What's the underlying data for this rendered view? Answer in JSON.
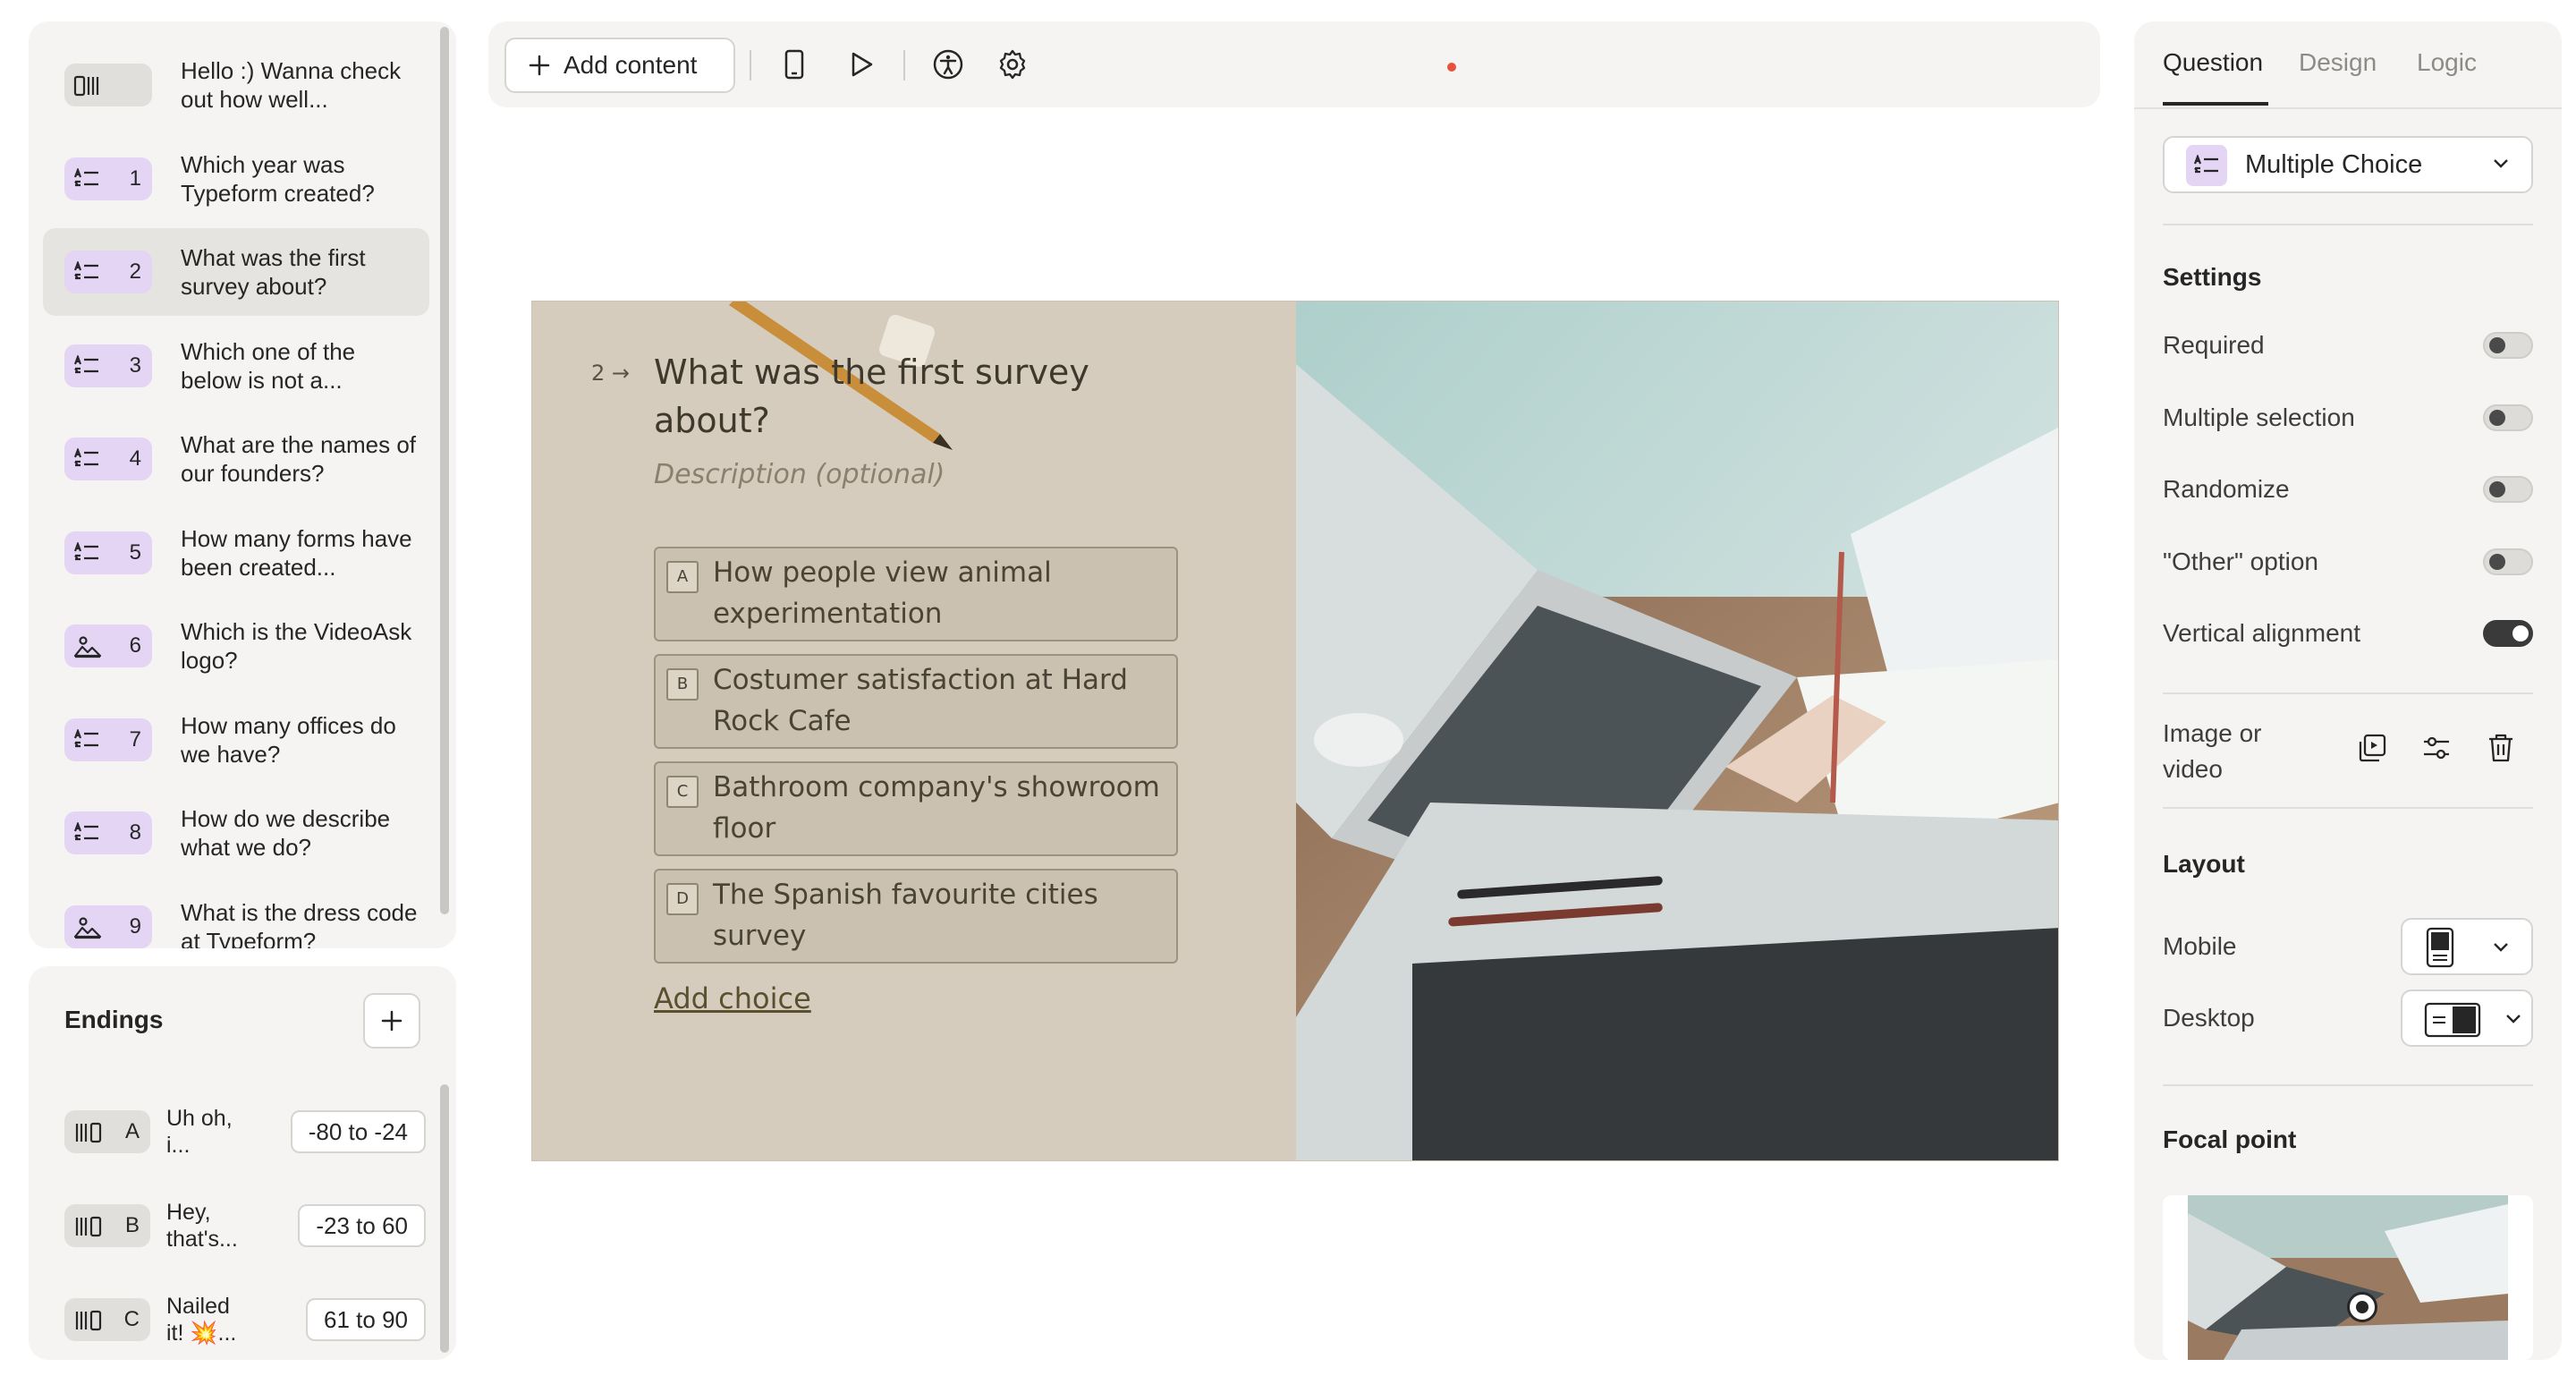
{
  "questions_panel": {
    "items": [
      {
        "num": "",
        "text": "Hello :) Wanna check out how well...",
        "icon": "welcome-screen-icon",
        "selected": false
      },
      {
        "num": "1",
        "text": "Which year was Typeform created?",
        "icon": "multiple-choice-icon",
        "selected": false
      },
      {
        "num": "2",
        "text": "What was the first survey about?",
        "icon": "multiple-choice-icon",
        "selected": true
      },
      {
        "num": "3",
        "text": "Which one of the below is not a...",
        "icon": "multiple-choice-icon",
        "selected": false
      },
      {
        "num": "4",
        "text": "What are the names of our founders?",
        "icon": "multiple-choice-icon",
        "selected": false
      },
      {
        "num": "5",
        "text": "How many forms have been created...",
        "icon": "multiple-choice-icon",
        "selected": false
      },
      {
        "num": "6",
        "text": "Which is the VideoAsk logo?",
        "icon": "picture-choice-icon",
        "selected": false
      },
      {
        "num": "7",
        "text": "How many offices do we have?",
        "icon": "multiple-choice-icon",
        "selected": false
      },
      {
        "num": "8",
        "text": "How do we describe what we do?",
        "icon": "multiple-choice-icon",
        "selected": false
      },
      {
        "num": "9",
        "text": "What is the dress code at Typeform?",
        "icon": "picture-choice-icon",
        "selected": false
      }
    ]
  },
  "endings": {
    "title": "Endings",
    "items": [
      {
        "key": "A",
        "text": "Uh oh, i...",
        "range": "-80 to -24"
      },
      {
        "key": "B",
        "text": "Hey, that's...",
        "range": "-23 to 60"
      },
      {
        "key": "C",
        "text": "Nailed it! 💥...",
        "range": "61 to 90"
      }
    ]
  },
  "toolbar": {
    "add_content_label": "Add content"
  },
  "canvas": {
    "question_number": "2",
    "question_title": "What was the first survey about?",
    "description_placeholder": "Description (optional)",
    "choices": [
      {
        "key": "A",
        "text": "How people view animal experimentation"
      },
      {
        "key": "B",
        "text": "Costumer satisfaction at Hard Rock Cafe"
      },
      {
        "key": "C",
        "text": "Bathroom company's showroom floor"
      },
      {
        "key": "D",
        "text": "The Spanish favourite cities survey"
      }
    ],
    "add_choice_label": "Add choice"
  },
  "right_panel": {
    "tabs": [
      {
        "label": "Question",
        "active": true
      },
      {
        "label": "Design",
        "active": false
      },
      {
        "label": "Logic",
        "active": false
      }
    ],
    "question_type": "Multiple Choice",
    "settings_title": "Settings",
    "settings": [
      {
        "label": "Required",
        "on": false
      },
      {
        "label": "Multiple selection",
        "on": false
      },
      {
        "label": "Randomize",
        "on": false
      },
      {
        "label": "\"Other\" option",
        "on": false
      },
      {
        "label": "Vertical alignment",
        "on": true
      }
    ],
    "image_or_video_label": "Image or video",
    "layout_title": "Layout",
    "layout_mobile_label": "Mobile",
    "layout_desktop_label": "Desktop",
    "focal_point_title": "Focal point"
  },
  "colors": {
    "accent_purple": "#e3d5f3",
    "panel_bg": "#f5f4f2",
    "slide_bg": "#d5ccbd",
    "notification_dot": "#e5533d"
  }
}
